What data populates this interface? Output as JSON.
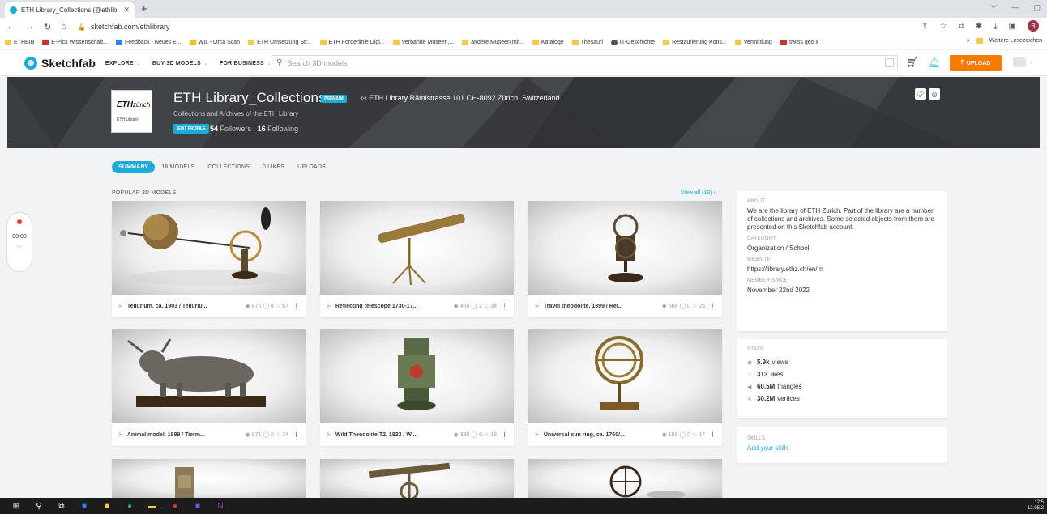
{
  "browser": {
    "tab_title": "ETH Library_Collections (@ethlib",
    "url": "sketchfab.com/ethlibrary",
    "bookmarks": [
      "ETHBIB",
      "E-Pics Wissenschaft...",
      "Feedback - Neues E...",
      "WIL - Orca Scan",
      "ETH Umsetzung Str...",
      "ETH Förderlinie Digi...",
      "Verbände Museen,...",
      "andere Museen mit...",
      "Kataloge",
      "Thesauri",
      "IT-Geschichte",
      "Restaurierung Kons...",
      "Vermittlung",
      "swiss geo x"
    ],
    "bookmarks_more": "Weitere Lesezeichen",
    "profile_initial": "B"
  },
  "header": {
    "logo": "Sketchfab",
    "menu": [
      "EXPLORE",
      "BUY 3D MODELS",
      "FOR BUSINESS"
    ],
    "search_placeholder": "Search 3D models",
    "upload_label": "UPLOAD"
  },
  "profile": {
    "name": "ETH Library_Collections",
    "badge": "PREMIUM",
    "location": "ETH Library Rämistrasse 101 CH-8092 Zürich, Switzerland",
    "description": "Collections and Archives of the ETH Library",
    "edit_label": "EDIT PROFILE",
    "followers_count": "54",
    "followers_label": "Followers",
    "following_count": "16",
    "following_label": "Following",
    "avatar_text": "ETH",
    "avatar_text2": "zürich",
    "avatar_sub": "ETH Library"
  },
  "tabs": [
    "SUMMARY",
    "18 MODELS",
    "COLLECTIONS",
    "0 LIKES",
    "UPLOADS"
  ],
  "popular_label": "POPULAR 3D MODELS",
  "view_all": "View all (18)",
  "models": [
    {
      "title": "Tellurium, ca. 1903 / Telluriu...",
      "views": "876",
      "comments": "4",
      "likes": "67"
    },
    {
      "title": "Reflecting telescope 1730-17...",
      "views": "456",
      "comments": "2",
      "likes": "34"
    },
    {
      "title": "Travel theodolite, 1899 / Rei...",
      "views": "564",
      "comments": "0",
      "likes": "25"
    },
    {
      "title": "Animal model, 1889 / Tierm...",
      "views": "871",
      "comments": "0",
      "likes": "24"
    },
    {
      "title": "Wild Theodolite T2, 1923 / W...",
      "views": "330",
      "comments": "0",
      "likes": "19"
    },
    {
      "title": "Universal sun ring, ca. 1760/...",
      "views": "188",
      "comments": "0",
      "likes": "17"
    }
  ],
  "about": {
    "label": "ABOUT",
    "text": "We are the library of ETH Zurich. Part of the library are a number of collections and archives. Some selected objects from them are presented on this Sketchfab account.",
    "category_label": "CATEGORY",
    "category": "Organization / School",
    "website_label": "WEBSITE",
    "website": "https://library.ethz.ch/en/",
    "member_label": "MEMBER SINCE",
    "member_since": "November 22nd 2022"
  },
  "stats": {
    "label": "STATS",
    "views": "5.9k",
    "views_label": "views",
    "likes": "313",
    "likes_label": "likes",
    "triangles": "60.5M",
    "triangles_label": "triangles",
    "vertices": "30.2M",
    "vertices_label": "vertices"
  },
  "skills": {
    "label": "SKILLS",
    "link": "Add your skills"
  },
  "recorder": {
    "time": "00:00"
  },
  "clock": {
    "time": "12:5",
    "date": "12.05.2"
  }
}
